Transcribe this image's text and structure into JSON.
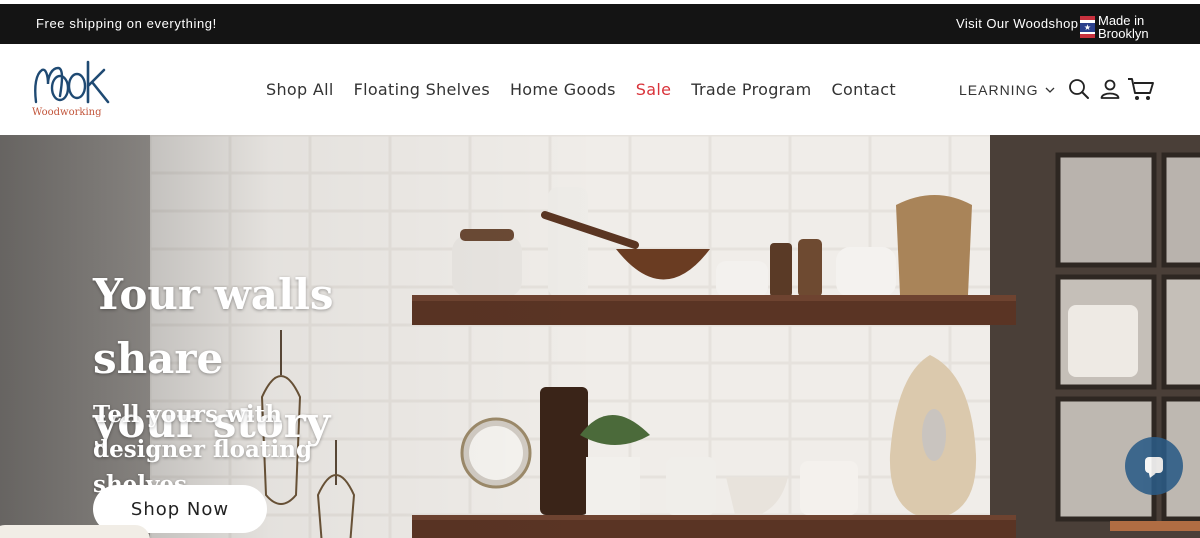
{
  "announcement": {
    "shipping": "Free shipping on everything!",
    "visit": "Visit Our Woodshop",
    "made_in_line1": "Made in",
    "made_in_line2": "Brooklyn"
  },
  "header": {
    "logo_tagline": "Woodworking",
    "nav": [
      {
        "label": "Shop All"
      },
      {
        "label": "Floating Shelves"
      },
      {
        "label": "Home Goods"
      },
      {
        "label": "Sale"
      },
      {
        "label": "Trade Program"
      },
      {
        "label": "Contact"
      }
    ],
    "learning": "LEARNING",
    "icons": [
      "search-icon",
      "account-icon",
      "cart-icon"
    ]
  },
  "hero": {
    "title_line1": "Your walls share",
    "title_line2": "your story",
    "sub_line1": "Tell yours with",
    "sub_line2": "designer floating shelves",
    "cta": "Shop Now"
  },
  "colors": {
    "announcement_bg": "#141414",
    "sale": "#d9333a",
    "logo": "#1f4a73",
    "chat": "#2b5b86"
  }
}
